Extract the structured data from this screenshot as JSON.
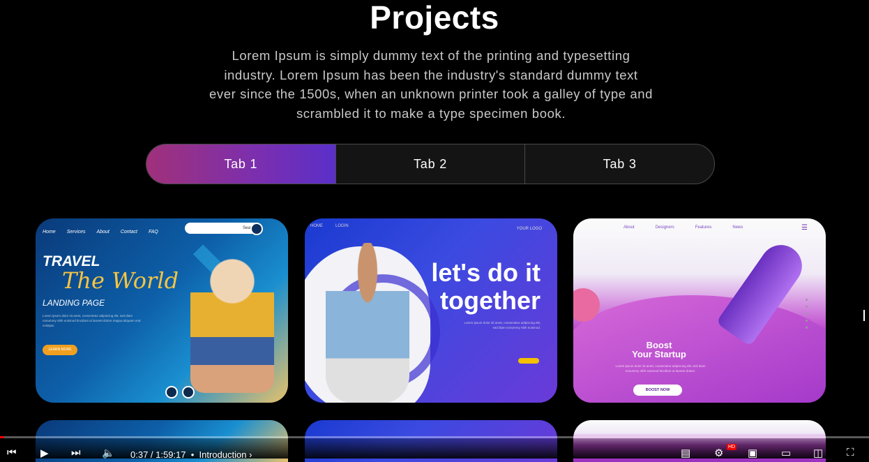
{
  "section": {
    "title": "Projects",
    "description": "Lorem Ipsum is simply dummy text of the printing and typesetting industry. Lorem Ipsum has been the industry's standard dummy text ever since the 1500s, when an unknown printer took a galley of type and scrambled it to make a type specimen book."
  },
  "tabs": [
    {
      "label": "Tab 1",
      "active": true
    },
    {
      "label": "Tab 2",
      "active": false
    },
    {
      "label": "Tab 3",
      "active": false
    }
  ],
  "cards": {
    "travel": {
      "nav": [
        "Home",
        "Services",
        "About",
        "Contact",
        "FAQ"
      ],
      "search": "Search",
      "title1": "TRAVEL",
      "title2": "The World",
      "subtitle": "LANDING PAGE",
      "body": "Lorem ipsum dolor sit amet, consectetur adipiscing elit, sed diam nonummy nibh euismod tincidunt ut laoreet dolore magna aliquam erat volutpat.",
      "button": "LEARN MORE"
    },
    "together": {
      "nav": [
        "HOME",
        "LOGIN"
      ],
      "logo": "YOUR LOGO",
      "headline": "let's do it together",
      "body": "Lorem ipsum dolor sit amet, consectetur adipiscing elit, sed diam nonummy nibh euismod."
    },
    "boost": {
      "nav": [
        "About",
        "Designers",
        "Features",
        "News"
      ],
      "menu_icon": "menu-icon",
      "headline1": "Boost",
      "headline2": "Your Startup",
      "body": "Lorem ipsum dolor sit amet, consectetur adipiscing elit, sed diam nonummy nibh euismod tincidunt ut laoreet dolore.",
      "button": "BOOST NOW"
    }
  },
  "player": {
    "time": "0:37 / 1:59:17",
    "chapter": "Introduction",
    "progress": 0.005,
    "hd_badge": "HD",
    "icons": [
      "previous-icon",
      "play-icon",
      "next-icon",
      "volume-icon",
      "subtitles-icon",
      "settings-icon",
      "miniplayer-icon",
      "theater-icon",
      "cast-icon",
      "fullscreen-icon"
    ]
  }
}
